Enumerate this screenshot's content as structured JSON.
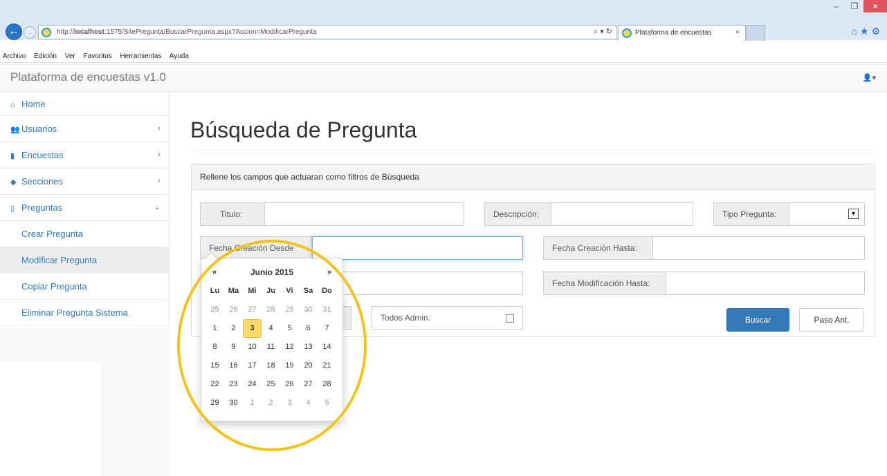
{
  "browser": {
    "url": "http://localhost:1575/SitePregunta/BuscarPregunta.aspx?Accion=ModificarPregunta",
    "url_host": "http://",
    "url_host_bold": "localhost",
    "url_rest": ":1575/SitePregunta/BuscarPregunta.aspx?Accion=ModificarPregunta",
    "tab_title": "Plataforma de encuestas",
    "menu": [
      "Archivo",
      "Edición",
      "Ver",
      "Favoritos",
      "Herramientas",
      "Ayuda"
    ]
  },
  "app": {
    "brand": "Plataforma de encuestas v1.0"
  },
  "sidebar": {
    "items": [
      {
        "label": "Home",
        "icon": "home-icon"
      },
      {
        "label": "Usuarios",
        "icon": "users-icon",
        "arrow": "‹"
      },
      {
        "label": "Encuestas",
        "icon": "bookmark-icon",
        "arrow": "‹"
      },
      {
        "label": "Secciones",
        "icon": "tags-icon",
        "arrow": "‹"
      },
      {
        "label": "Preguntas",
        "icon": "bookmark-outline-icon",
        "arrow": "⌄"
      }
    ],
    "subitems": [
      "Crear Pregunta",
      "Modificar Pregunta",
      "Copiar Pregunta",
      "Eliminar Pregunta Sistema"
    ],
    "active_subitem": "Modificar Pregunta"
  },
  "main": {
    "title": "Búsqueda de Pregunta",
    "panel_heading": "Rellene los campos que actuaran como filtros de Búsqueda",
    "labels": {
      "titulo": "Titulo:",
      "descripcion": "Descripción:",
      "tipo_pregunta": "Tipo Pregunta:",
      "fecha_creacion_desde": "Fecha Creación Desde",
      "fecha_creacion_hasta": "Fecha Creación Hasta:",
      "fecha_modificacion_hasta": "Fecha Modificación Hasta:",
      "todos_admin": "Todos Admin."
    },
    "buttons": {
      "buscar": "Buscar",
      "paso_ant": "Paso Ant."
    }
  },
  "datepicker": {
    "prev": "«",
    "next": "»",
    "month": "Junio 2015",
    "weekdays": [
      "Lu",
      "Ma",
      "Mi",
      "Ju",
      "Vi",
      "Sa",
      "Do"
    ],
    "days": [
      [
        "25",
        "26",
        "27",
        "28",
        "29",
        "30",
        "31"
      ],
      [
        "1",
        "2",
        "3",
        "4",
        "5",
        "6",
        "7"
      ],
      [
        "8",
        "9",
        "10",
        "11",
        "12",
        "13",
        "14"
      ],
      [
        "15",
        "16",
        "17",
        "18",
        "19",
        "20",
        "21"
      ],
      [
        "22",
        "23",
        "24",
        "25",
        "26",
        "27",
        "28"
      ],
      [
        "29",
        "30",
        "1",
        "2",
        "3",
        "4",
        "5"
      ]
    ],
    "highlighted_day": "3",
    "highlight_color": "#fdd96a"
  },
  "colors": {
    "link": "#337ab7",
    "primary": "#337ab7",
    "annotation_ring": "#f2c31a"
  }
}
